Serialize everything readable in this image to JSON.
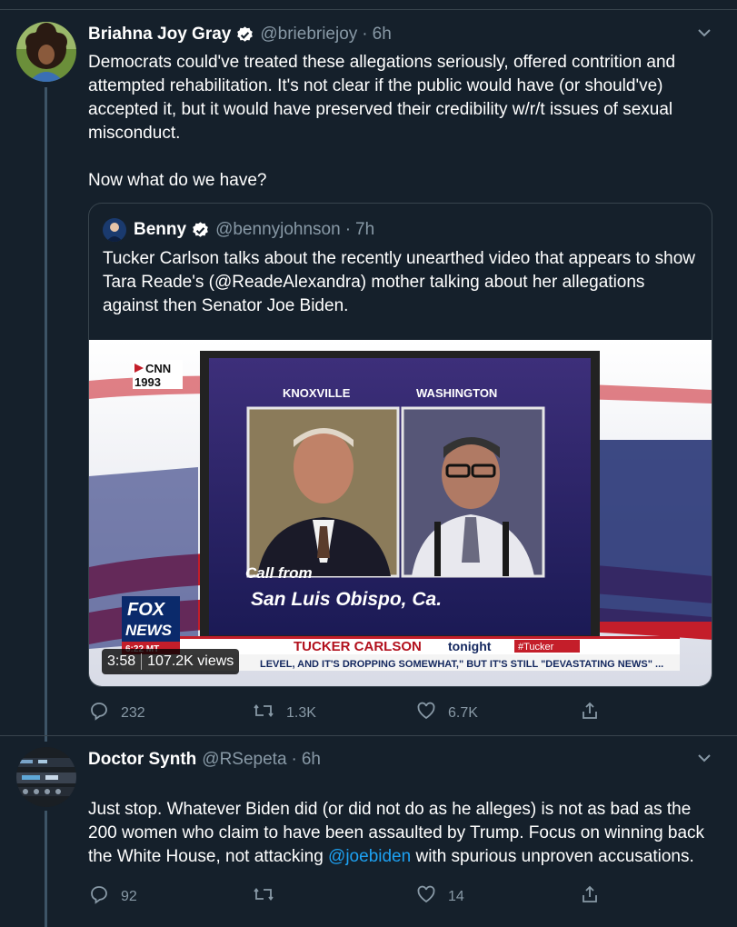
{
  "tweets": [
    {
      "name": "Briahna Joy Gray",
      "handle": "@briebriejoy",
      "dot": "·",
      "time": "6h",
      "text": "Democrats could've treated these allegations seriously, offered contrition and attempted rehabilitation. It's not clear if the public would have (or should've) accepted it, but it would have preserved their credibility w/r/t issues of sexual misconduct.\n\nNow what do we have?",
      "quote": {
        "name": "Benny",
        "handle": "@bennyjohnson",
        "dot": "·",
        "time": "7h",
        "text": "Tucker Carlson talks about the recently unearthed video that appears to show Tara Reade's (@ReadeAlexandra) mother talking about her allegations against then Senator Joe Biden.",
        "video": {
          "duration": "3:58",
          "views": "107.2K views",
          "overlay": {
            "cnn_top": "CNN",
            "cnn_bottom": "1993",
            "left_city": "KNOXVILLE",
            "right_city": "WASHINGTON",
            "call_line1": "Call from",
            "call_line2": "San Luis Obispo, Ca.",
            "fox_top": "FOX",
            "fox_bottom": "NEWS",
            "fox_time": "6:22 MT",
            "show_title": "TUCKER CARLSON",
            "show_sub": "tonight",
            "hashtag": "#Tucker",
            "ticker": "LEVEL, AND IT'S DROPPING SOMEWHAT,\" BUT IT'S STILL \"DEVASTATING NEWS\" ..."
          }
        }
      },
      "counts": {
        "reply": "232",
        "retweet": "1.3K",
        "like": "6.7K"
      }
    },
    {
      "name": "Doctor Synth",
      "handle": "@RSepeta",
      "dot": "·",
      "time": "6h",
      "text_before": "Just stop. Whatever Biden did (or did not do as he alleges) is not as bad as the 200 women who claim to have been assaulted by Trump. Focus on winning back the White House, not attacking ",
      "mention": "@joebiden",
      "text_after": " with spurious unproven accusations.",
      "counts": {
        "reply": "92",
        "retweet": "",
        "like": "14"
      }
    }
  ],
  "colors": {
    "background": "#15202b",
    "text": "#ffffff",
    "muted": "#8899a6",
    "link": "#1da1f2",
    "border": "#38444d"
  }
}
